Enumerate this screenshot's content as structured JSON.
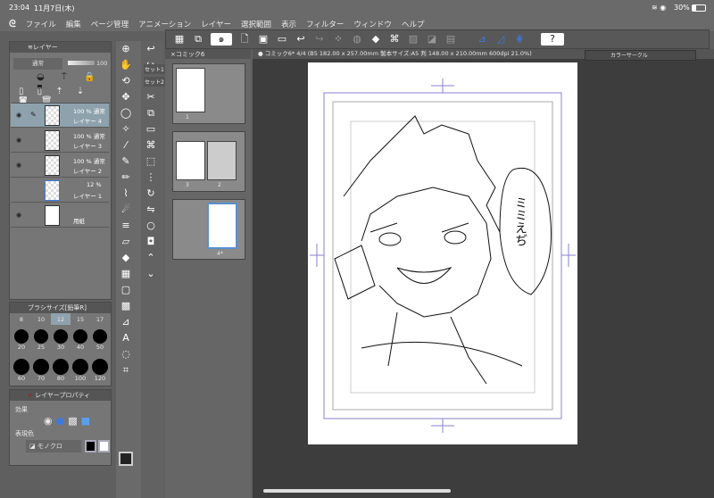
{
  "status": {
    "time": "23:04",
    "date": "11月7日(木)",
    "battery": "30%"
  },
  "menu": [
    "ファイル",
    "編集",
    "ページ管理",
    "アニメーション",
    "レイヤー",
    "選択範囲",
    "表示",
    "フィルター",
    "ウィンドウ",
    "ヘルプ"
  ],
  "layers_panel": {
    "tab": "レイヤー",
    "blend_mode": "通常",
    "opacity": "100",
    "layers": [
      {
        "top": "100 % 通常",
        "name": "レイヤー 4",
        "selected": true
      },
      {
        "top": "100 % 通常",
        "name": "レイヤー 3"
      },
      {
        "top": "100 % 通常",
        "name": "レイヤー 2"
      },
      {
        "top": "12 %",
        "name": "レイヤー 1"
      },
      {
        "top": "",
        "name": "用紙"
      }
    ]
  },
  "brush_panel": {
    "tab": "ブラシサイズ[鉛筆R]",
    "sizes": [
      "8",
      "10",
      "12",
      "15",
      "17"
    ],
    "rows": [
      [
        "20",
        "25",
        "30",
        "40",
        "50"
      ],
      [
        "60",
        "70",
        "80",
        "100",
        "120"
      ]
    ],
    "selected": "12"
  },
  "layer_props": {
    "tab": "レイヤープロパティ",
    "effect_label": "効果",
    "color_label": "表現色",
    "color_mode": "モノクロ"
  },
  "pages_panel": {
    "tab": "コミック6",
    "tab2_a": "セット1",
    "tab2_b": "セット2",
    "pages": [
      "1",
      "3",
      "2",
      "4*"
    ]
  },
  "canvas": {
    "tab": "コミック6* 4/4 (B5 182.00 x 257.00mm 製本サイズ:A5 判 148.00 x 210.00mm 600dpi 21.0%)",
    "bubble_text": "ミミえぢ"
  },
  "color_circle": {
    "title": "カラーサークル"
  }
}
